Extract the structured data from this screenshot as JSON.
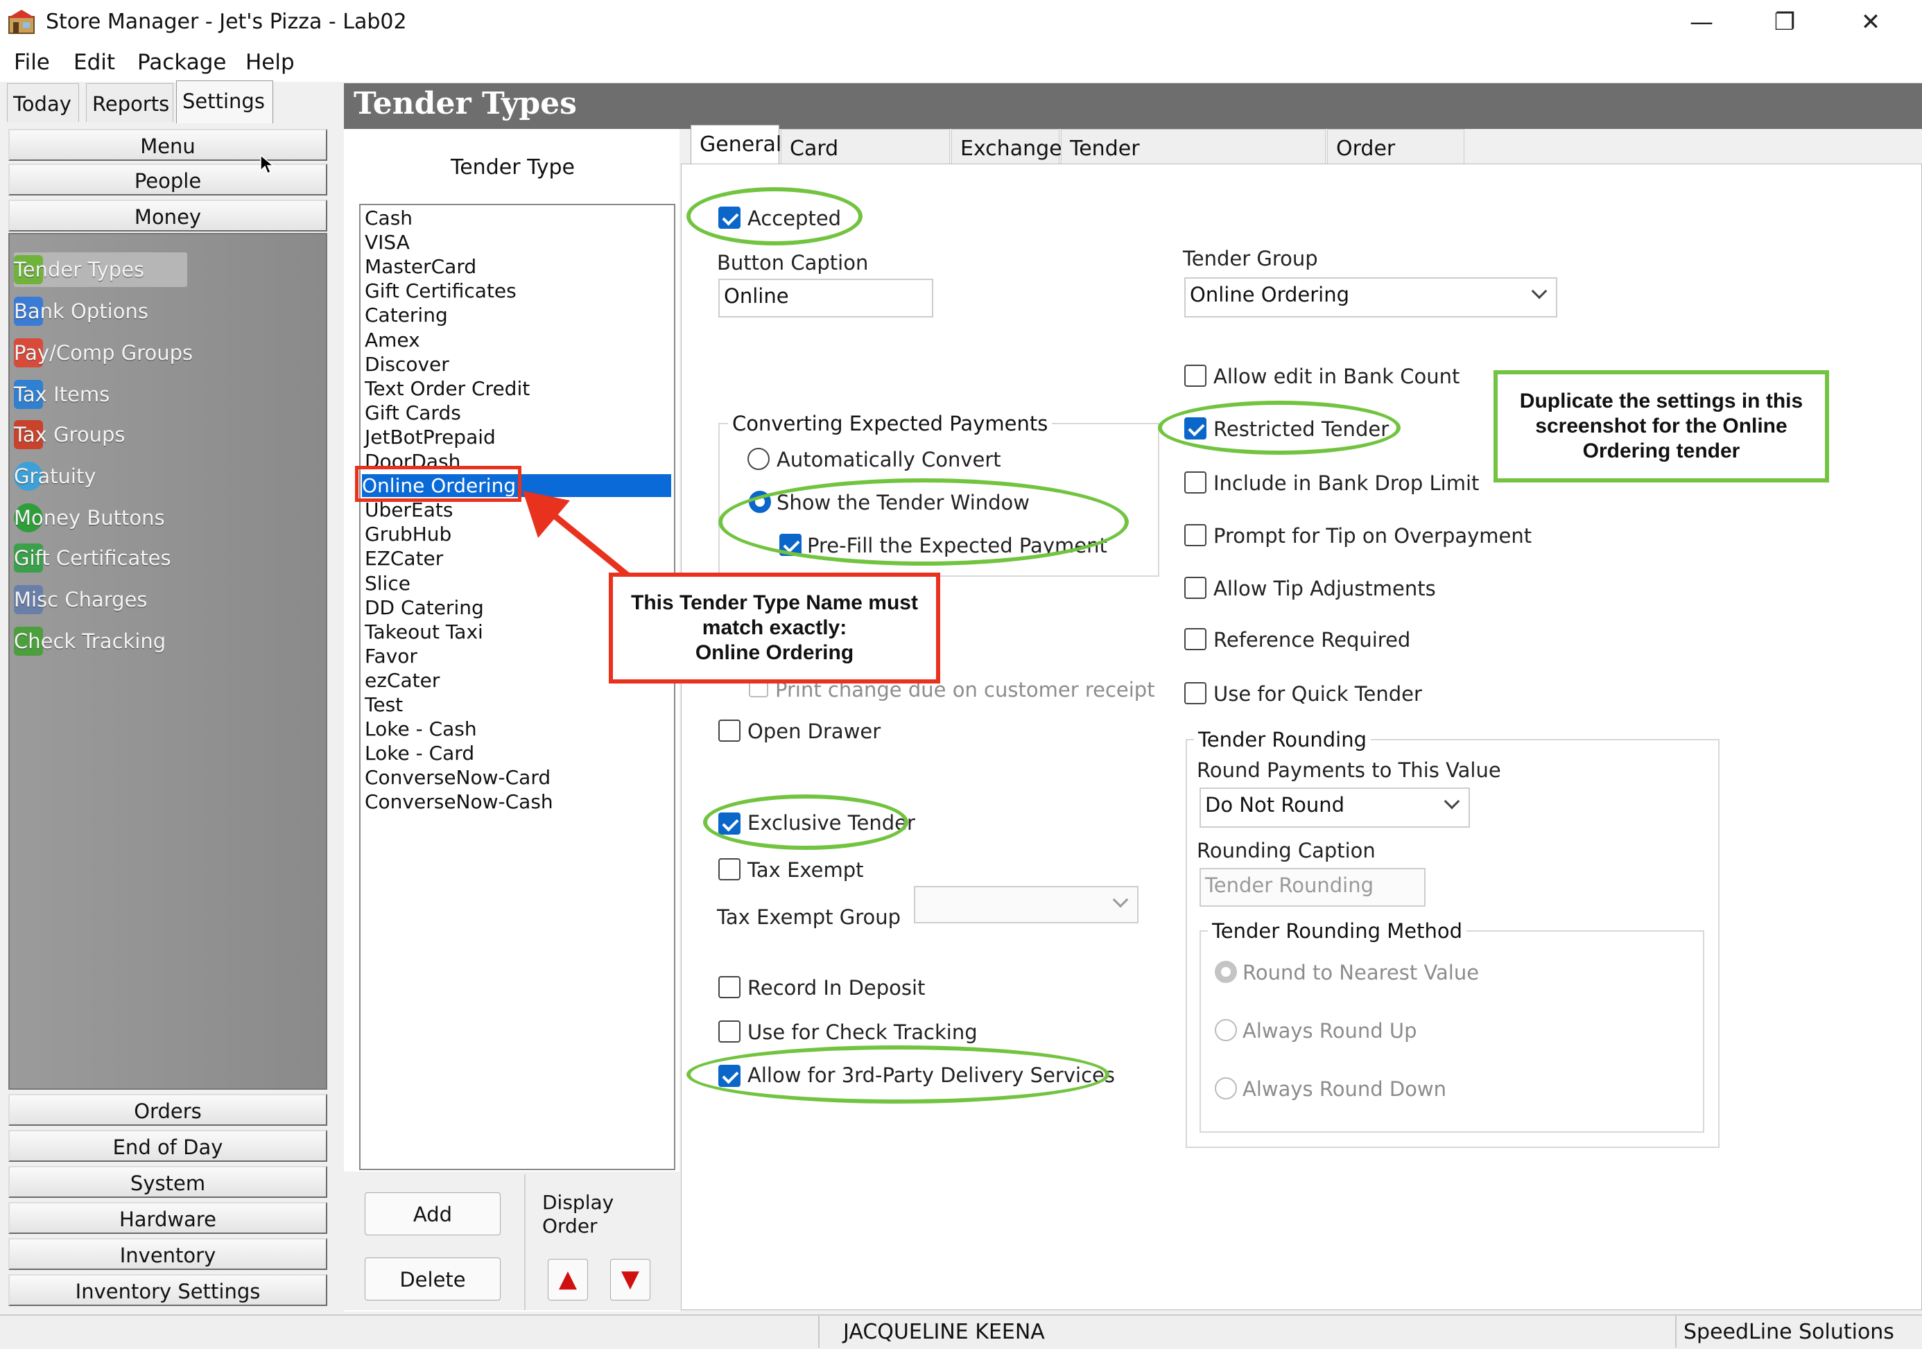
{
  "window": {
    "title": "Store Manager - Jet's Pizza - Lab02",
    "minimize": "—",
    "maximize": "❐",
    "close": "✕"
  },
  "menu": [
    "File",
    "Edit",
    "Package",
    "Help"
  ],
  "top_tabs": [
    "Today",
    "Reports",
    "Settings"
  ],
  "nav_top": [
    "Menu",
    "People",
    "Money"
  ],
  "nav_items": [
    {
      "label": "Tender Types",
      "icon": "tender-types-icon",
      "color": "#6fb33a"
    },
    {
      "label": "Bank Options",
      "icon": "bank-options-icon",
      "color": "#3a7bd5"
    },
    {
      "label": "Pay/Comp Groups",
      "icon": "pay-comp-icon",
      "color": "#d84b3a"
    },
    {
      "label": "Tax Items",
      "icon": "tax-items-icon",
      "color": "#2f80d1"
    },
    {
      "label": "Tax Groups",
      "icon": "tax-groups-icon",
      "color": "#c8422c"
    },
    {
      "label": "Gratuity",
      "icon": "gratuity-icon",
      "color": "#3ea0d8"
    },
    {
      "label": "Money Buttons",
      "icon": "money-buttons-icon",
      "color": "#2e9e3a"
    },
    {
      "label": "Gift Certificates",
      "icon": "gift-certificates-icon",
      "color": "#3aa04a"
    },
    {
      "label": "Misc Charges",
      "icon": "misc-charges-icon",
      "color": "#6a7fa8"
    },
    {
      "label": "Check Tracking",
      "icon": "check-tracking-icon",
      "color": "#4c9f3c"
    }
  ],
  "nav_bottom": [
    "Orders",
    "End of Day",
    "System",
    "Hardware",
    "Inventory",
    "Inventory Settings"
  ],
  "header_title": "Tender Types",
  "tender_list": {
    "heading": "Tender Type",
    "items": [
      "Cash",
      "VISA",
      "MasterCard",
      "Gift Certificates",
      "Catering",
      "Amex",
      "Discover",
      "Text Order Credit",
      "Gift Cards",
      "JetBotPrepaid",
      "DoorDash",
      "Online Ordering",
      "UberEats",
      "GrubHub",
      "EZCater",
      "Slice",
      "DD Catering",
      "Takeout Taxi",
      "Favor",
      "ezCater",
      "Test",
      "Loke - Cash",
      "Loke - Card",
      "ConverseNow-Card",
      "ConverseNow-Cash"
    ],
    "selected": "Online Ordering",
    "add": "Add",
    "delete": "Delete",
    "display_order": "Display\nOrder",
    "display_order_l1": "Display",
    "display_order_l2": "Order",
    "up": "▲",
    "down": "▼"
  },
  "tabs": [
    "General",
    "Card Information",
    "Exchange",
    "Tender Surcharge/Discount",
    "Order Types"
  ],
  "general": {
    "accepted": "Accepted",
    "button_caption_label": "Button Caption",
    "button_caption": "Online",
    "tender_group_label": "Tender Group",
    "tender_group": "Online Ordering",
    "converting_title": "Converting Expected Payments",
    "auto_convert": "Automatically Convert",
    "show_tender": "Show the Tender Window",
    "prefill": "Pre-Fill the Expected Payment",
    "print_change": "Print change due on customer receipt",
    "open_drawer": "Open Drawer",
    "exclusive": "Exclusive Tender",
    "tax_exempt": "Tax Exempt",
    "tax_exempt_group": "Tax Exempt Group",
    "record_deposit": "Record In Deposit",
    "check_tracking": "Use for Check Tracking",
    "third_party": "Allow for 3rd-Party Delivery Services",
    "allow_edit": "Allow edit in Bank Count",
    "restricted": "Restricted Tender",
    "bank_drop": "Include in Bank Drop Limit",
    "prompt_tip": "Prompt for Tip on Overpayment",
    "tip_adjust": "Allow Tip Adjustments",
    "reference": "Reference Required",
    "quick_tender": "Use for Quick Tender",
    "rounding_title": "Tender Rounding",
    "round_payments_label": "Round Payments to This Value",
    "round_payments": "Do Not Round",
    "rounding_caption_label": "Rounding Caption",
    "rounding_caption": "Tender Rounding",
    "method_title": "Tender Rounding Method",
    "round_nearest": "Round to Nearest Value",
    "round_up": "Always Round Up",
    "round_down": "Always Round Down"
  },
  "annotations": {
    "name_note_l1": "This Tender Type Name must",
    "name_note_l2": "match exactly:",
    "name_note_l3": "Online Ordering",
    "dup_note_l1": "Duplicate the settings in this",
    "dup_note_l2": "screenshot for the Online",
    "dup_note_l3": "Ordering tender",
    "red": "#e8321e",
    "green": "#72c440"
  },
  "status": {
    "user": "JACQUELINE KEENA",
    "company": "SpeedLine Solutions"
  }
}
